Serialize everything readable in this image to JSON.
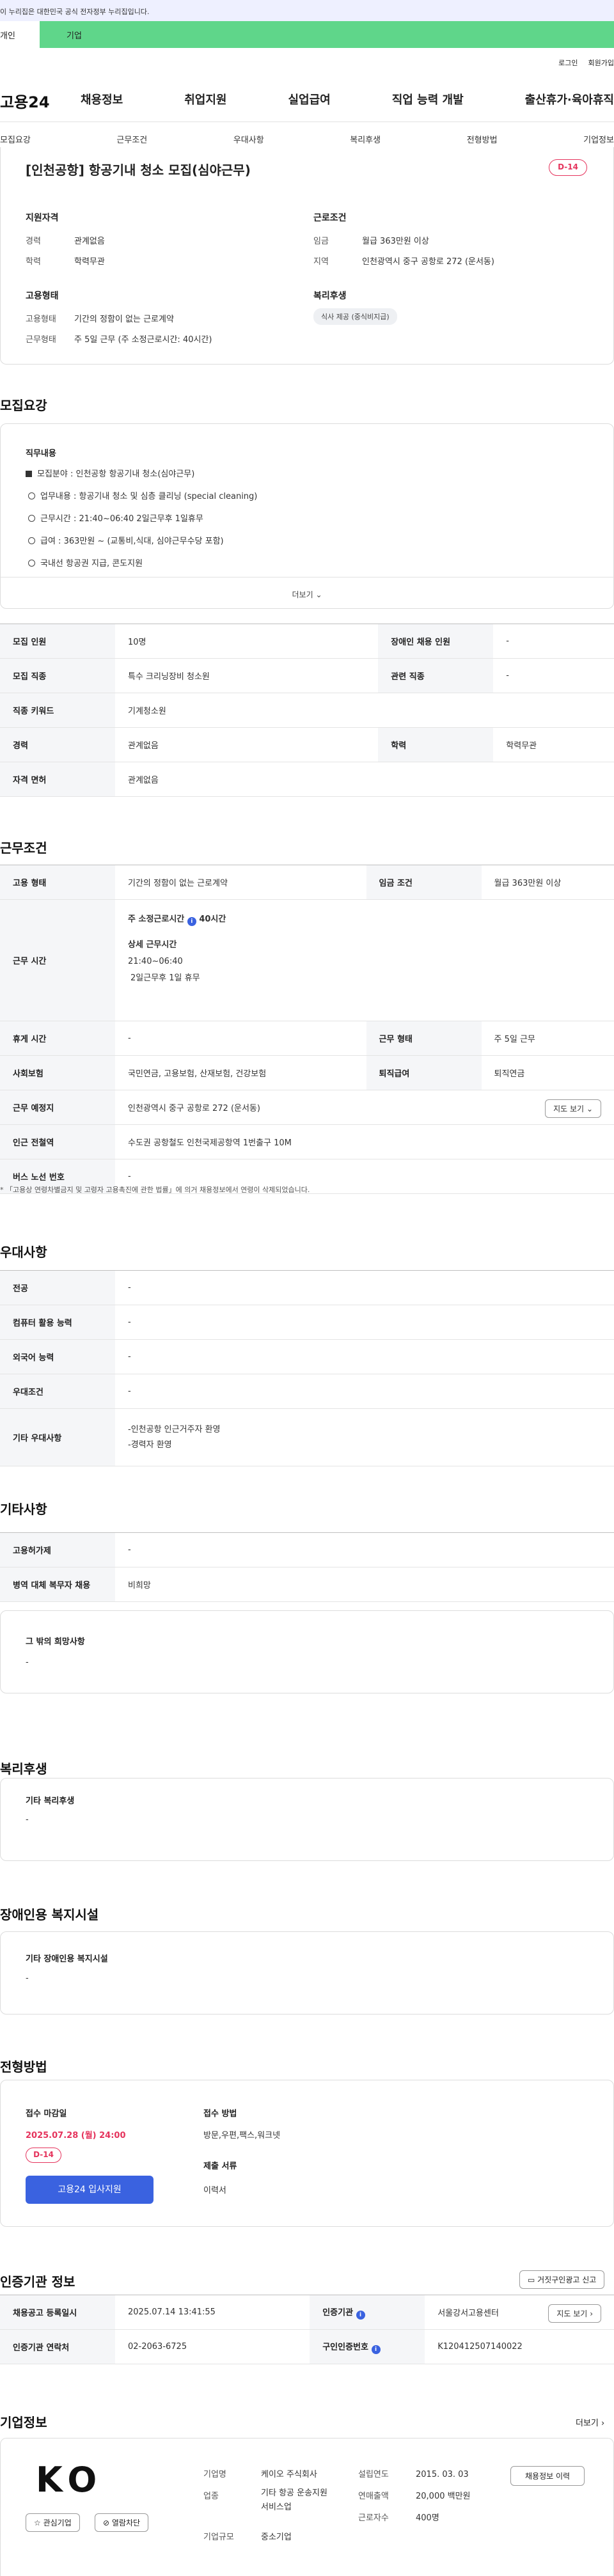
{
  "gov_notice": "이 누리집은 대한민국 공식 전자정부 누리집입니다.",
  "top_tabs": {
    "personal": "개인",
    "company": "기업"
  },
  "user_links": [
    "로그인",
    "회원가입"
  ],
  "logo": "고용24",
  "main_nav": [
    "채용정보",
    "취업지원",
    "실업급여",
    "직업 능력 개발",
    "출산휴가·육아휴직"
  ],
  "sub_nav": [
    "모집요강",
    "근무조건",
    "우대사항",
    "복리후생",
    "전형방법",
    "기업정보"
  ],
  "summary": {
    "title": "[인천공항] 항공기내 청소 모집(심야근무)",
    "dday": "D-14",
    "qual_heading": "지원자격",
    "qual": [
      [
        "경력",
        "관계없음"
      ],
      [
        "학력",
        "학력무관"
      ]
    ],
    "cond_heading": "근로조건",
    "cond": [
      [
        "임금",
        "월급 363만원 이상"
      ],
      [
        "지역",
        "인천광역시 중구 공항로 272 (운서동)"
      ]
    ],
    "emp_heading": "고용형태",
    "emp": [
      [
        "고용형태",
        "기간의 정함이 없는 근로계약"
      ],
      [
        "근무형태",
        "주 5일 근무 (주 소정근로시간: 40시간)"
      ]
    ],
    "welfare_heading": "복리후생",
    "welfare_pill": "식사 제공 (중식비지급)"
  },
  "recruit": {
    "heading": "모집요강",
    "duty_title": "직무내용",
    "duties": [
      "모집분야 : 인천공항 항공기내 청소(심야근무)",
      "업무내용 : 항공기내 청소 및 심층 클리닝 (special cleaning)",
      "근무시간 : 21:40~06:40    2일근무후 1일휴무",
      "급여 : 363만원 ~ (교통비,식대, 심야근무수당 포함)",
      "국내선 항공권 지급,  콘도지원"
    ],
    "more": "더보기",
    "table": [
      [
        "모집 인원",
        "10명",
        "장애인 채용 인원",
        "-"
      ],
      [
        "모집 직종",
        "특수 크리닝장비 청소원",
        "관련 직종",
        "-"
      ],
      [
        "직종 키워드",
        "기계청소원",
        "",
        ""
      ],
      [
        "경력",
        "관계없음",
        "학력",
        "학력무관"
      ],
      [
        "자격 면허",
        "관계없음",
        "",
        ""
      ]
    ]
  },
  "conditions": {
    "heading": "근무조건",
    "emp_type_label": "고용 형태",
    "emp_type": "기간의 정함이 없는 근로계약",
    "wage_label": "임금 조건",
    "wage": "월급 363만원 이상",
    "hours_label": "근무 시간",
    "hours_title": "주 소정근로시간",
    "hours_value": "40시간",
    "hours_detail_title": "상세 근무시간",
    "hours_detail_1": "21:40~06:40",
    "hours_detail_2": "2일근무후 1일 휴무",
    "rest_label": "휴게 시간",
    "rest": "-",
    "work_type_label": "근무 형태",
    "work_type": "주 5일 근무",
    "insurance_label": "사회보험",
    "insurance": "국민연금, 고용보험, 산재보험, 건강보험",
    "retire_label": "퇴직급여",
    "retire": "퇴직연금",
    "place_label": "근무 예정지",
    "place": "인천광역시 중구 공항로 272 (운서동)",
    "map_btn": "지도 보기",
    "station_label": "인근 전철역",
    "station": "수도권 공항철도 인천국제공항역 1번출구 10M",
    "bus_label": "버스 노선 번호",
    "bus": "-",
    "note": "「고용상 연령차별금지 및 고령자 고용촉진에 관한 법률」에 의거 채용정보에서 연령이 삭제되었습니다."
  },
  "preference": {
    "heading": "우대사항",
    "rows": [
      [
        "전공",
        "-"
      ],
      [
        "컴퓨터 활용 능력",
        "-"
      ],
      [
        "외국어 능력",
        "-"
      ],
      [
        "우대조건",
        "-"
      ]
    ],
    "etc_label": "기타 우대사항",
    "etc_1": "-인천공항 인근거주자 환영",
    "etc_2": "-경력자 환영"
  },
  "other": {
    "heading": "기타사항",
    "rows": [
      [
        "고용허가제",
        "-"
      ],
      [
        "병역 대체 복무자 채용",
        "비희망"
      ]
    ],
    "hope_title": "그 밖의 희망사항",
    "hope": "-"
  },
  "welfare": {
    "heading": "복리후생",
    "title": "기타 복리후생",
    "value": "-"
  },
  "disabled": {
    "heading": "장애인용 복지시설",
    "title": "기타 장애인용 복지시설",
    "value": "-"
  },
  "selection": {
    "heading": "전형방법",
    "deadline_title": "접수 마감일",
    "deadline": "2025.07.28 (월) 24:00",
    "dday": "D-14",
    "apply_btn": "고용24 입사지원",
    "method_title": "접수 방법",
    "method": "방문,우편,팩스,워크넷",
    "docs_title": "제출 서류",
    "docs": "이력서"
  },
  "agency": {
    "heading": "인증기관 정보",
    "report_btn": "거짓구인광고 신고",
    "reg_label": "채용공고 등록일시",
    "reg": "2025.07.14 13:41:55",
    "agency_label": "인증기관",
    "agency": "서울강서고용센터",
    "map_btn": "지도 보기",
    "contact_label": "인증기관 연락처",
    "contact": "02-2063-6725",
    "cert_label": "구인인증번호",
    "cert": "K120412507140022"
  },
  "company": {
    "heading": "기업정보",
    "more": "더보기",
    "logo_text": "KO",
    "fav_btn": "관심기업",
    "block_btn": "열람차단",
    "name_label": "기업명",
    "name": "케이오 주식회사",
    "industry_label": "업종",
    "industry": "기타 항공 운송지원 서비스업",
    "size_label": "기업규모",
    "size": "중소기업",
    "founded_label": "설립연도",
    "founded": "2015. 03. 03",
    "sales_label": "연매출액",
    "sales": "20,000 백만원",
    "employees_label": "근로자수",
    "employees": "400명",
    "history_btn": "채용정보 이력"
  }
}
